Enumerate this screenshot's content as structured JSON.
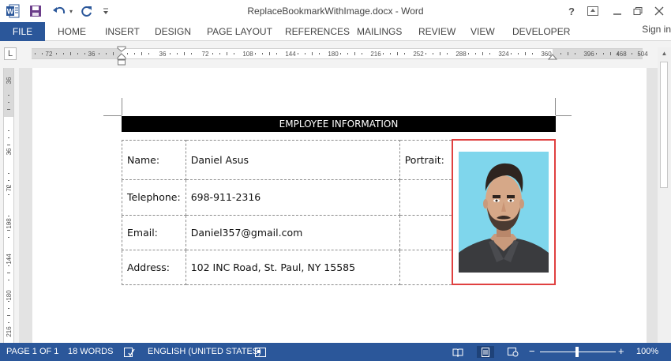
{
  "app": {
    "window_title": "ReplaceBookmarkWithImage.docx - Word",
    "help": "?",
    "sign_in": "Sign in"
  },
  "ribbon": {
    "file_tab": "FILE",
    "tabs": [
      "HOME",
      "INSERT",
      "DESIGN",
      "PAGE LAYOUT",
      "REFERENCES",
      "MAILINGS",
      "REVIEW",
      "VIEW",
      "DEVELOPER"
    ]
  },
  "ruler": {
    "corner_label": "L",
    "horizontal_ticks": [
      "72",
      "36",
      "36",
      "72",
      "108",
      "144",
      "180",
      "216",
      "252",
      "288",
      "324",
      "360",
      "396",
      "468",
      "504"
    ],
    "vertical_ticks": [
      "36",
      "36",
      "72",
      "108",
      "144",
      "180",
      "216"
    ]
  },
  "document": {
    "header": "EMPLOYEE INFORMATION",
    "rows": [
      {
        "label": "Name:",
        "value": "Daniel Asus"
      },
      {
        "label": "Telephone:",
        "value": "698-911-2316"
      },
      {
        "label": "Email:",
        "value": "Daniel357@gmail.com"
      },
      {
        "label": "Address:",
        "value": "102 INC Road, St. Paul, NY 15585"
      }
    ],
    "portrait_label": "Portrait:",
    "portrait_icon": "employee-portrait-image"
  },
  "status_bar": {
    "page": "PAGE 1 OF 1",
    "words": "18 WORDS",
    "language": "ENGLISH (UNITED STATES)",
    "zoom_minus": "−",
    "zoom_plus": "+",
    "zoom": "100%"
  },
  "colors": {
    "accent": "#2b579a",
    "portrait_border": "#e04040",
    "header_bg": "#000000"
  }
}
